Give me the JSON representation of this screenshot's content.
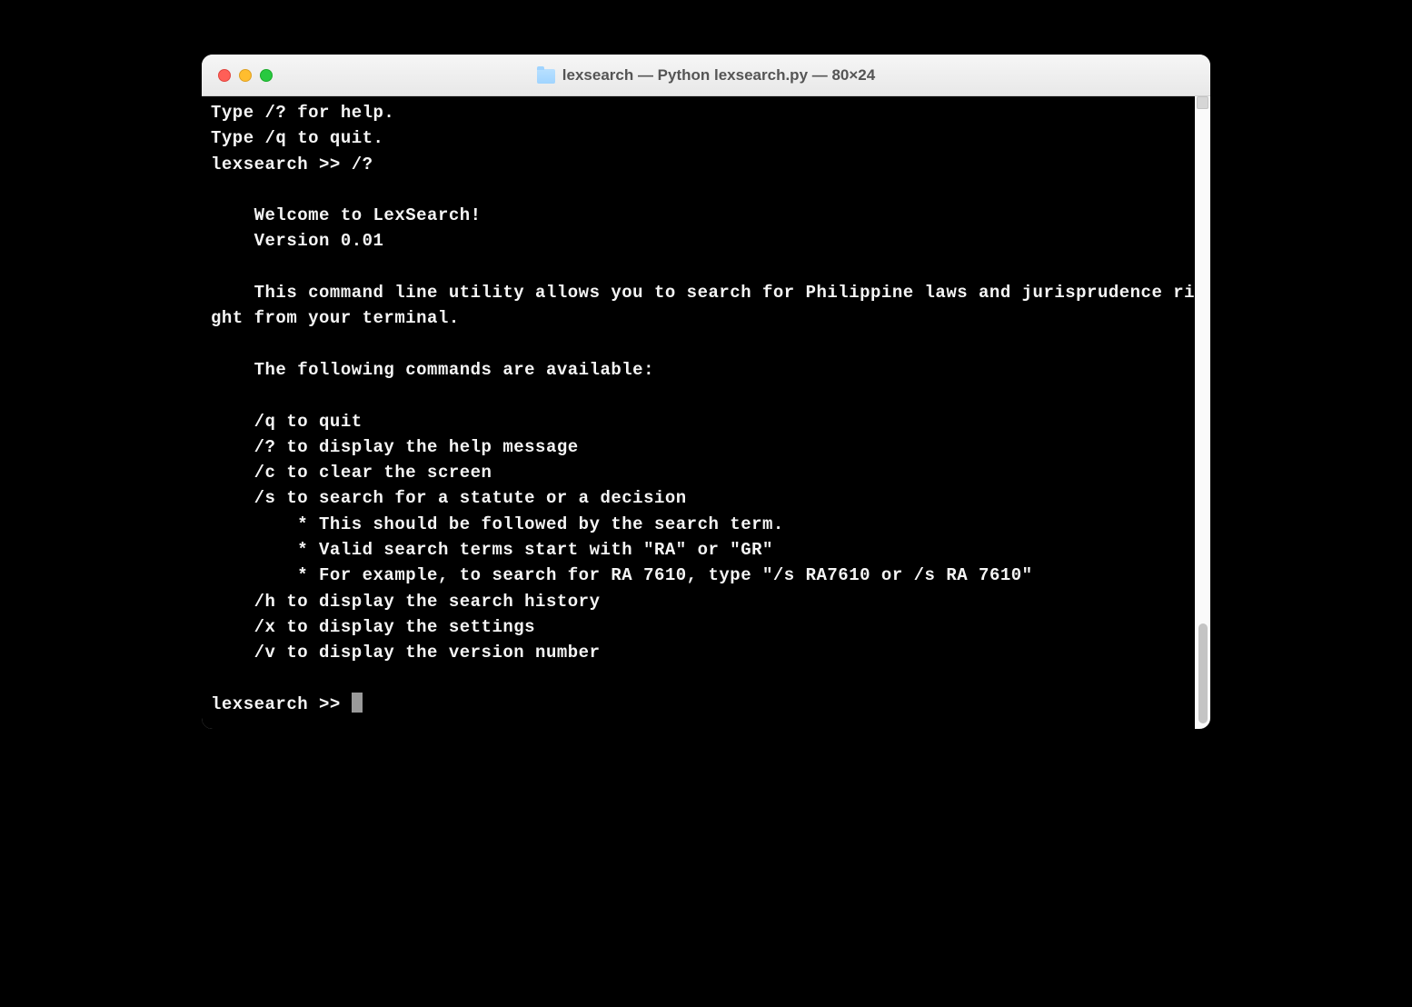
{
  "window": {
    "title": "lexsearch — Python lexsearch.py — 80×24",
    "icon": "folder-icon"
  },
  "terminal": {
    "lines": [
      "Type /? for help.",
      "Type /q to quit.",
      "lexsearch >> /?",
      "",
      "    Welcome to LexSearch!",
      "    Version 0.01",
      "",
      "    This command line utility allows you to search for Philippine laws and jurisprudence right from your terminal.",
      "",
      "    The following commands are available:",
      "",
      "    /q to quit",
      "    /? to display the help message",
      "    /c to clear the screen",
      "    /s to search for a statute or a decision",
      "        * This should be followed by the search term.",
      "        * Valid search terms start with \"RA\" or \"GR\"",
      "        * For example, to search for RA 7610, type \"/s RA7610 or /s RA 7610\"",
      "    /h to display the search history",
      "    /x to display the settings",
      "    /v to display the version number",
      ""
    ],
    "prompt": "lexsearch >> "
  }
}
